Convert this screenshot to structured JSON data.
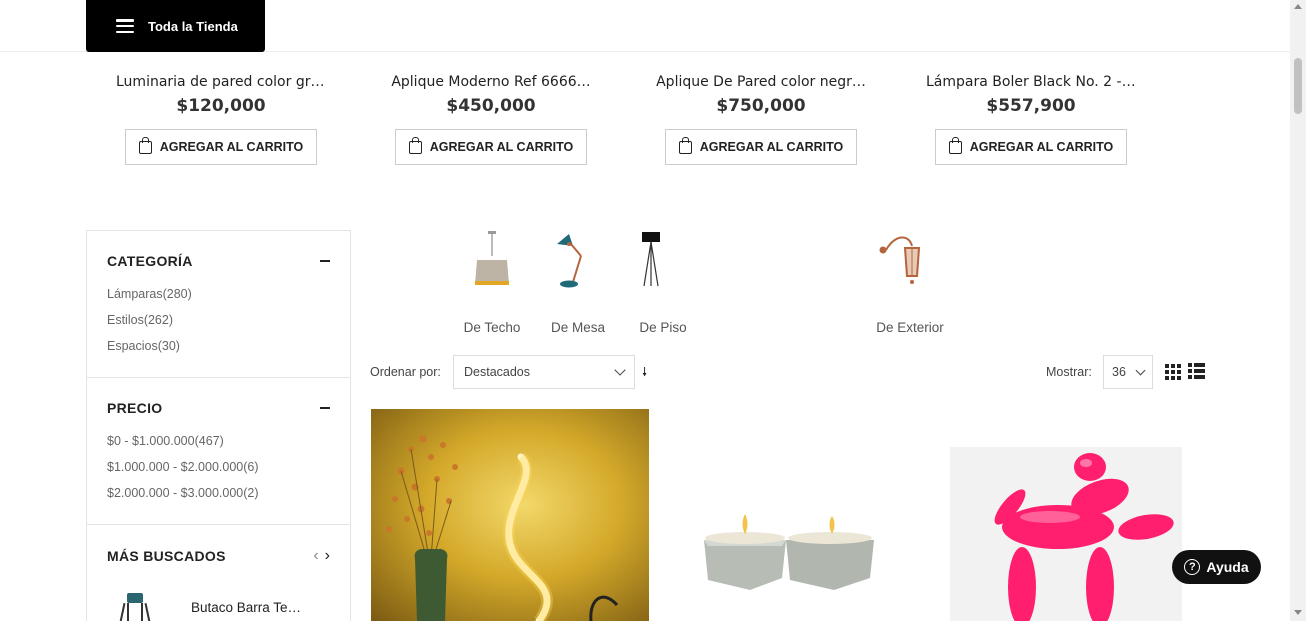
{
  "header": {
    "menu_button_label": "Toda la Tienda",
    "menu_icon": "hamburger-icon"
  },
  "top_products": [
    {
      "name": "Luminaria de pared color gri…",
      "price": "$120,000",
      "button_label": "AGREGAR AL CARRITO"
    },
    {
      "name": "Aplique Moderno Ref 6666…",
      "price": "$450,000",
      "button_label": "AGREGAR AL CARRITO"
    },
    {
      "name": "Aplique De Pared color negr…",
      "price": "$750,000",
      "button_label": "AGREGAR AL CARRITO"
    },
    {
      "name": "Lámpara Boler Black No. 2 - …",
      "price": "$557,900",
      "button_label": "AGREGAR AL CARRITO"
    }
  ],
  "sidebar": {
    "categoria": {
      "title": "CATEGORÍA",
      "items": [
        {
          "label": "Lámparas(280)"
        },
        {
          "label": "Estilos(262)"
        },
        {
          "label": "Espacios(30)"
        }
      ]
    },
    "precio": {
      "title": "PRECIO",
      "items": [
        {
          "label": "$0 - $1.000.000(467)"
        },
        {
          "label": "$1.000.000 - $2.000.000(6)"
        },
        {
          "label": "$2.000.000 - $3.000.000(2)"
        }
      ]
    },
    "mas_buscados": {
      "title": "MÁS BUSCADOS",
      "items": [
        {
          "name": "Butaco Barra Te…"
        }
      ]
    }
  },
  "categories": [
    {
      "label": "De Techo",
      "icon": "ceiling-lamp-icon"
    },
    {
      "label": "De Mesa",
      "icon": "desk-lamp-icon"
    },
    {
      "label": "De Piso",
      "icon": "floor-lamp-icon"
    },
    {
      "label": "De Exterior",
      "icon": "outdoor-lamp-icon"
    }
  ],
  "toolbar": {
    "order_label": "Ordenar por:",
    "order_value": "Destacados",
    "show_label": "Mostrar:",
    "show_value": "36"
  },
  "help": {
    "label": "Ayuda",
    "icon": "?"
  },
  "colors": {
    "menu_bg": "#000000",
    "teal_accent": "#2a6570",
    "copper": "#b5653d",
    "pink_product": "#ff1f6e"
  }
}
